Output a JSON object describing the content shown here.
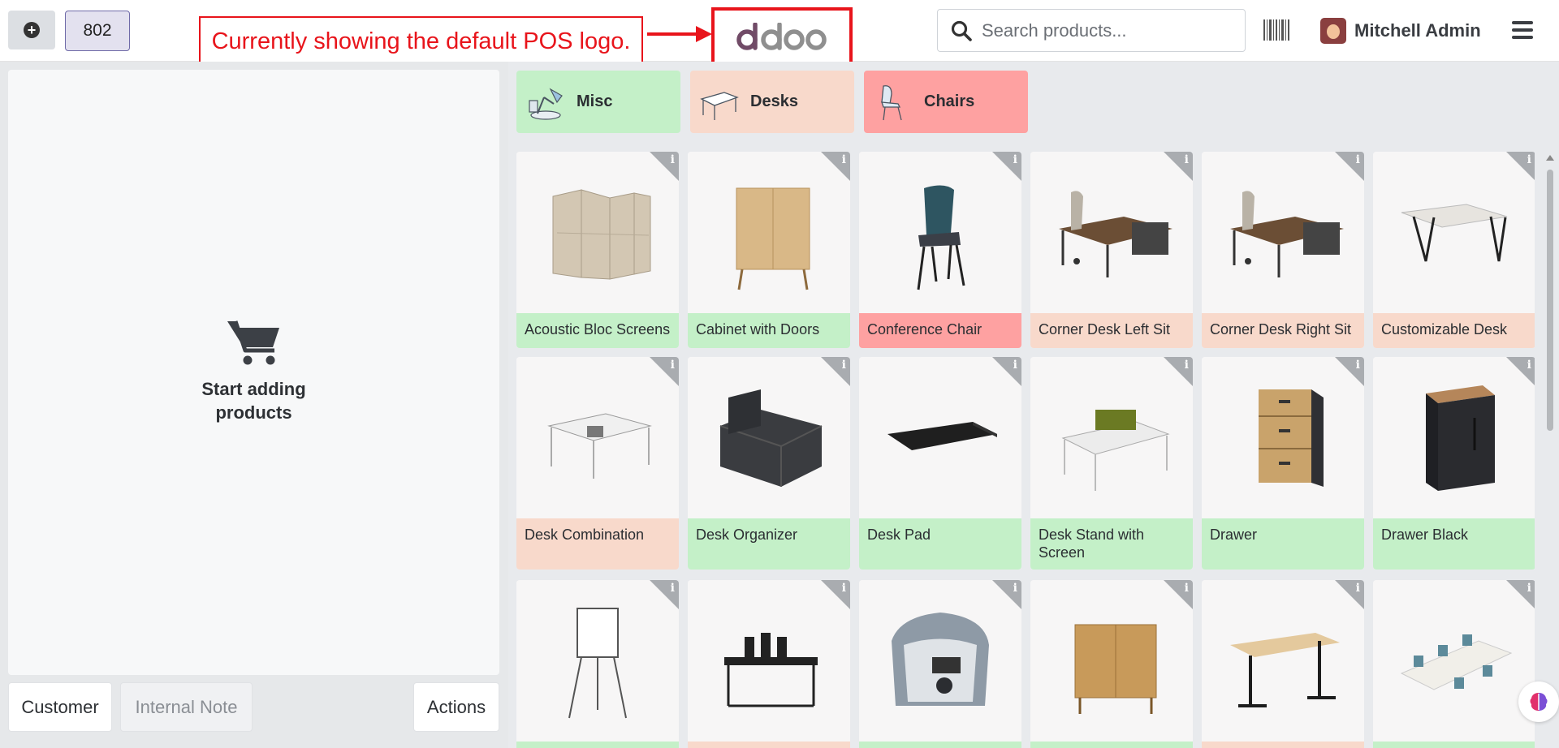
{
  "header": {
    "order_number": "802",
    "annotation": "Currently showing the default POS logo.",
    "logo_text": "odoo",
    "search_placeholder": "Search products...",
    "user_name": "Mitchell Admin"
  },
  "categories": [
    {
      "label": "Misc",
      "color": "#c4f0c8"
    },
    {
      "label": "Desks",
      "color": "#f8d9cb"
    },
    {
      "label": "Chairs",
      "color": "#fea1a1"
    }
  ],
  "order": {
    "empty_text": "Start adding products",
    "customer_label": "Customer",
    "note_label": "Internal Note",
    "actions_label": "Actions"
  },
  "products": [
    {
      "name": "Acoustic Bloc Screens",
      "color": "green",
      "icon": "acoustic-screens-image"
    },
    {
      "name": "Cabinet with Doors",
      "color": "green",
      "icon": "cabinet-image"
    },
    {
      "name": "Conference Chair",
      "color": "red",
      "icon": "chair-image"
    },
    {
      "name": "Corner Desk Left Sit",
      "color": "peach",
      "icon": "corner-desk-image"
    },
    {
      "name": "Corner Desk Right Sit",
      "color": "peach",
      "icon": "corner-desk-image"
    },
    {
      "name": "Customizable Desk",
      "color": "peach",
      "icon": "desk-image"
    },
    {
      "name": "Desk Combination",
      "color": "peach",
      "icon": "desk-combination-image"
    },
    {
      "name": "Desk Organizer",
      "color": "green",
      "icon": "desk-organizer-image"
    },
    {
      "name": "Desk Pad",
      "color": "green",
      "icon": "desk-pad-image"
    },
    {
      "name": "Desk Stand with Screen",
      "color": "green",
      "icon": "desk-stand-image"
    },
    {
      "name": "Drawer",
      "color": "green",
      "icon": "drawer-image"
    },
    {
      "name": "Drawer Black",
      "color": "green",
      "icon": "drawer-black-image"
    },
    {
      "name": "",
      "color": "green",
      "icon": "flipchart-image"
    },
    {
      "name": "",
      "color": "peach",
      "icon": "desk-cluster-image"
    },
    {
      "name": "",
      "color": "green",
      "icon": "office-pod-image"
    },
    {
      "name": "",
      "color": "green",
      "icon": "sideboard-image"
    },
    {
      "name": "",
      "color": "peach",
      "icon": "standing-desk-image"
    },
    {
      "name": "",
      "color": "green",
      "icon": "meeting-table-image"
    }
  ]
}
